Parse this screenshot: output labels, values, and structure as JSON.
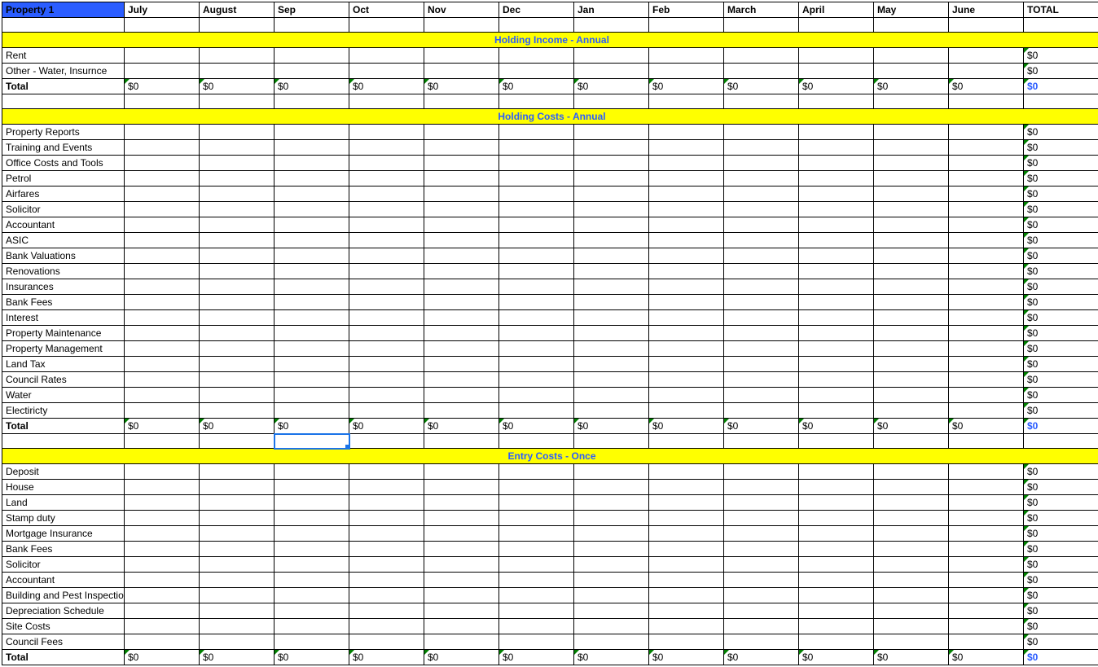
{
  "header": {
    "property": "Property 1",
    "months": [
      "July",
      "August",
      "Sep",
      "Oct",
      "Nov",
      "Dec",
      "Jan",
      "Feb",
      "March",
      "April",
      "May",
      "June"
    ],
    "total": "TOTAL"
  },
  "sections": [
    {
      "title": "Holding Income - Annual",
      "rows": [
        {
          "label": "Rent",
          "total": "$0"
        },
        {
          "label": "Other - Water, Insurnce",
          "total": "$0"
        }
      ],
      "totals": {
        "label": "Total",
        "months": [
          "$0",
          "$0",
          "$0",
          "$0",
          "$0",
          "$0",
          "$0",
          "$0",
          "$0",
          "$0",
          "$0",
          "$0"
        ],
        "grand": "$0"
      }
    },
    {
      "title": "Holding Costs - Annual",
      "rows": [
        {
          "label": "Property Reports",
          "total": "$0"
        },
        {
          "label": "Training and Events",
          "total": "$0"
        },
        {
          "label": "Office Costs and Tools",
          "total": "$0"
        },
        {
          "label": "Petrol",
          "total": "$0"
        },
        {
          "label": "Airfares",
          "total": "$0"
        },
        {
          "label": "Solicitor",
          "total": "$0"
        },
        {
          "label": "Accountant",
          "total": "$0"
        },
        {
          "label": "ASIC",
          "total": "$0"
        },
        {
          "label": "Bank Valuations",
          "total": "$0"
        },
        {
          "label": "Renovations",
          "total": "$0"
        },
        {
          "label": "Insurances",
          "total": "$0"
        },
        {
          "label": "Bank Fees",
          "total": "$0"
        },
        {
          "label": "Interest",
          "total": "$0"
        },
        {
          "label": "Property Maintenance",
          "total": "$0"
        },
        {
          "label": "Property Management",
          "total": "$0"
        },
        {
          "label": "Land Tax",
          "total": "$0"
        },
        {
          "label": "Council Rates",
          "total": "$0"
        },
        {
          "label": "Water",
          "total": "$0"
        },
        {
          "label": "Electiricty",
          "total": "$0"
        }
      ],
      "totals": {
        "label": "Total",
        "months": [
          "$0",
          "$0",
          "$0",
          "$0",
          "$0",
          "$0",
          "$0",
          "$0",
          "$0",
          "$0",
          "$0",
          "$0"
        ],
        "grand": "$0"
      },
      "selected_cell_month_index": 2
    },
    {
      "title": "Entry Costs - Once",
      "rows": [
        {
          "label": "Deposit",
          "total": "$0"
        },
        {
          "label": "House",
          "total": "$0"
        },
        {
          "label": "Land",
          "total": "$0"
        },
        {
          "label": "Stamp duty",
          "total": "$0"
        },
        {
          "label": "Mortgage Insurance",
          "total": "$0"
        },
        {
          "label": "Bank Fees",
          "total": "$0"
        },
        {
          "label": "Solicitor",
          "total": "$0"
        },
        {
          "label": "Accountant",
          "total": "$0"
        },
        {
          "label": "Building and Pest Inspection",
          "total": "$0"
        },
        {
          "label": "Depreciation Schedule",
          "total": "$0"
        },
        {
          "label": "Site Costs",
          "total": "$0"
        },
        {
          "label": "Council Fees",
          "total": "$0"
        }
      ],
      "totals": {
        "label": "Total",
        "months": [
          "$0",
          "$0",
          "$0",
          "$0",
          "$0",
          "$0",
          "$0",
          "$0",
          "$0",
          "$0",
          "$0",
          "$0"
        ],
        "grand": "$0"
      }
    }
  ]
}
